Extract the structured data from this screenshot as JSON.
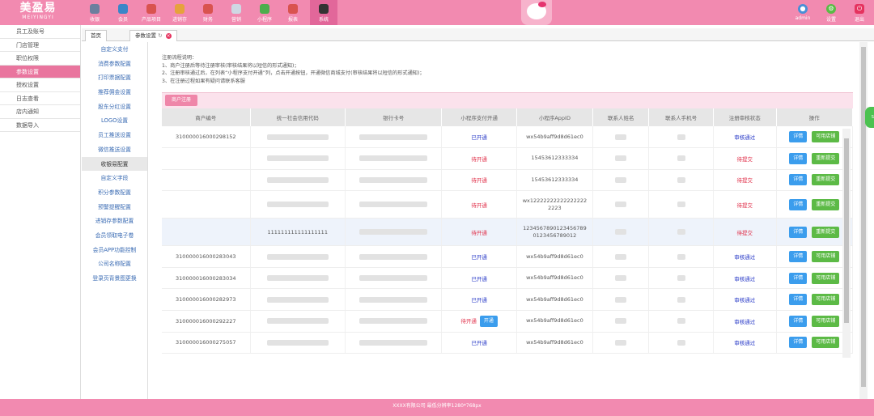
{
  "brand": {
    "name_cn": "美盈易",
    "name_en": "MEIYINGYI"
  },
  "top_nav": [
    {
      "label": "收银",
      "icon": "cashier-icon",
      "color": "#6b7f9e"
    },
    {
      "label": "会员",
      "icon": "member-icon",
      "color": "#3a86c8"
    },
    {
      "label": "产品项目",
      "icon": "product-icon",
      "color": "#d9534f"
    },
    {
      "label": "进销存",
      "icon": "inventory-icon",
      "color": "#e6a23c"
    },
    {
      "label": "财务",
      "icon": "finance-icon",
      "color": "#d9534f"
    },
    {
      "label": "营销",
      "icon": "marketing-icon",
      "color": "#cfd8e3"
    },
    {
      "label": "小程序",
      "icon": "miniapp-icon",
      "color": "#4cae4c"
    },
    {
      "label": "报表",
      "icon": "report-icon",
      "color": "#d9534f"
    },
    {
      "label": "系统",
      "icon": "system-icon",
      "color": "#333333"
    }
  ],
  "user": {
    "name": "admin",
    "settings": "设置",
    "logout": "退出"
  },
  "sidebar": [
    "员工及账号",
    "门店管理",
    "职位权限",
    "参数设置",
    "授权设置",
    "日志查看",
    "店内通知",
    "数据导入"
  ],
  "tabs": {
    "home": "首页",
    "current": "参数设置"
  },
  "submenu": [
    "自定义支付",
    "消费参数配置",
    "打印票据配置",
    "推荐佣金设置",
    "股东分红设置",
    "LOGO设置",
    "员工推送设置",
    "微信推送设置",
    "收银易配置",
    "自定义字段",
    "积分参数配置",
    "预警提醒配置",
    "进销存参数配置",
    "会员领取电子卷",
    "会员APP功能控制",
    "公司名称配置",
    "登录页背景图更换"
  ],
  "notes": {
    "title": "注册流程说明：",
    "l1": "1、商户注册后等待注册审核(审核结果将以短信的形式通知)；",
    "l2": "2、注册审核通过后，在列表“小程序支付开通”列，点击开通按钮，开通微信商城支付(审核结果将以短信的形式通知)；",
    "l3": "3、在注册过程如果有疑问请联系客服"
  },
  "register_button": "商户注册",
  "table": {
    "headers": [
      "商户编号",
      "统一社会信用代码",
      "银行卡号",
      "小程序支付开通",
      "小程序AppID",
      "联系人姓名",
      "联系人手机号",
      "注册审核状态",
      "操作"
    ],
    "detail_label": "详情",
    "open_label": "开通",
    "rows": [
      {
        "id": "310000016000298152",
        "credit": "",
        "pay": "已开通",
        "pay_state": "open",
        "appid": "wx54b9aff9d8d61ec0",
        "audit": "审核通过",
        "audit_state": "ok",
        "action": "可用店铺"
      },
      {
        "id": "",
        "credit": "",
        "pay": "待开通",
        "pay_state": "pend",
        "appid": "15453612333334",
        "audit": "待提交",
        "audit_state": "wait",
        "action": "重新提交"
      },
      {
        "id": "",
        "credit": "",
        "pay": "待开通",
        "pay_state": "pend",
        "appid": "15453612333334",
        "audit": "待提交",
        "audit_state": "wait",
        "action": "重新提交"
      },
      {
        "id": "",
        "credit": "",
        "pay": "待开通",
        "pay_state": "pend",
        "appid": "wx122222222222222222223",
        "audit": "待提交",
        "audit_state": "wait",
        "action": "重新提交"
      },
      {
        "id": "",
        "credit": "111111111111111111",
        "pay": "待开通",
        "pay_state": "pend",
        "appid": "1234567890123456789012345678901​2",
        "audit": "待提交",
        "audit_state": "wait",
        "action": "重新提交"
      },
      {
        "id": "310000016000283043",
        "credit": "",
        "pay": "已开通",
        "pay_state": "open",
        "appid": "wx54b9aff9d8d61ec0",
        "audit": "审核通过",
        "audit_state": "ok",
        "action": "可用店铺"
      },
      {
        "id": "310000016000283034",
        "credit": "",
        "pay": "已开通",
        "pay_state": "open",
        "appid": "wx54b9aff9d8d61ec0",
        "audit": "审核通过",
        "audit_state": "ok",
        "action": "可用店铺"
      },
      {
        "id": "310000016000282973",
        "credit": "",
        "pay": "已开通",
        "pay_state": "open",
        "appid": "wx54b9aff9d8d61ec0",
        "audit": "审核通过",
        "audit_state": "ok",
        "action": "可用店铺"
      },
      {
        "id": "310000016000292227",
        "credit": "",
        "pay": "待开通",
        "pay_state": "pend",
        "appid": "wx54b9aff9d8d61ec0",
        "audit": "审核通过",
        "audit_state": "ok",
        "action": "可用店铺",
        "show_open": true
      },
      {
        "id": "310000016000275057",
        "credit": "",
        "pay": "已开通",
        "pay_state": "open",
        "appid": "wx54b9aff9d8d61ec0",
        "audit": "审核通过",
        "audit_state": "ok",
        "action": "可用店铺"
      }
    ]
  },
  "footer": "XXXX有限公司   最低分辨率1280*768px"
}
